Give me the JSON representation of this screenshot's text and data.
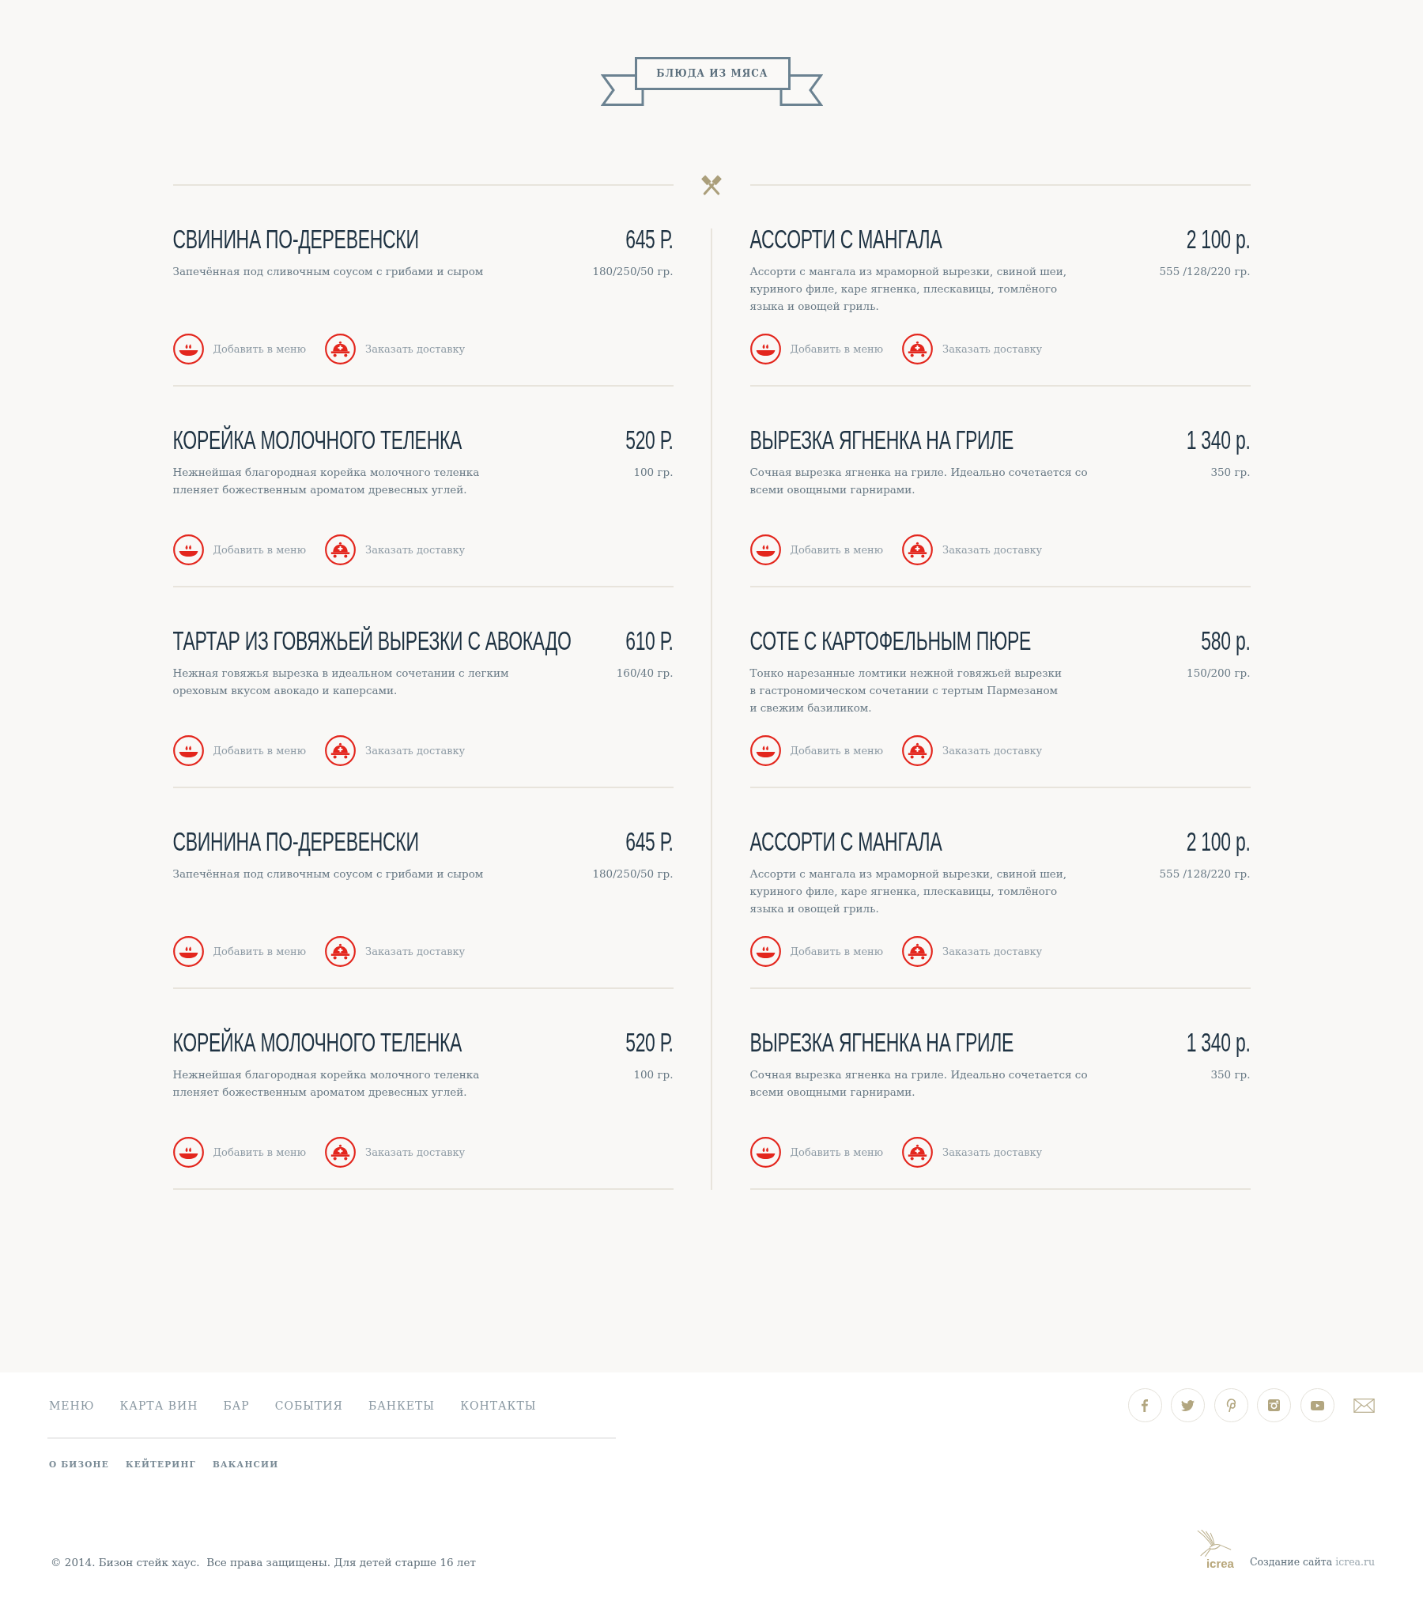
{
  "section_title": "БЛЮДА ИЗ МЯСА",
  "columns": [
    {
      "dishes": [
        {
          "name": "СВИНИНА ПО-ДЕРЕВЕНСКИ",
          "price": "645 Р.",
          "description": "Запечённая под сливочным соусом с грибами и сыром",
          "weight": "180/250/50 гр.",
          "actions": [
            {
              "kind": "add_to_menu",
              "label": "Добавить в меню"
            },
            {
              "kind": "order_delivery",
              "label": "Заказать доставку"
            }
          ]
        },
        {
          "name": "КОРЕЙКА МОЛОЧНОГО ТЕЛЕНКА",
          "price": "520 Р.",
          "description": "Нежнейшая благородная корейка молочного теленка\nпленяет божественным ароматом древесных углей.",
          "weight": "100 гр.",
          "actions": [
            {
              "kind": "add_to_menu",
              "label": "Добавить в меню"
            },
            {
              "kind": "order_delivery",
              "label": "Заказать доставку"
            }
          ]
        },
        {
          "name": "ТАРТАР ИЗ ГОВЯЖЬЕЙ ВЫРЕЗКИ С АВОКАДО",
          "price": "610 Р.",
          "description": "Нежная говяжья вырезка в идеальном сочетании с легким\nореховым вкусом авокадо и каперсами.",
          "weight": "160/40 гр.",
          "actions": [
            {
              "kind": "add_to_menu",
              "label": "Добавить в меню"
            },
            {
              "kind": "order_delivery",
              "label": "Заказать доставку"
            }
          ]
        },
        {
          "name": "СВИНИНА ПО-ДЕРЕВЕНСКИ",
          "price": "645 Р.",
          "description": "Запечённая под сливочным соусом с грибами и сыром",
          "weight": "180/250/50 гр.",
          "actions": [
            {
              "kind": "add_to_menu",
              "label": "Добавить в меню"
            },
            {
              "kind": "order_delivery",
              "label": "Заказать доставку"
            }
          ]
        },
        {
          "name": "КОРЕЙКА МОЛОЧНОГО ТЕЛЕНКА",
          "price": "520 Р.",
          "description": "Нежнейшая благородная корейка молочного теленка\nпленяет божественным ароматом древесных углей.",
          "weight": "100 гр.",
          "actions": [
            {
              "kind": "add_to_menu",
              "label": "Добавить в меню"
            },
            {
              "kind": "order_delivery",
              "label": "Заказать доставку"
            }
          ]
        }
      ]
    },
    {
      "dishes": [
        {
          "name": "АССОРТИ С МАНГАЛА",
          "price": "2 100 р.",
          "description": "Ассорти с мангала из мраморной вырезки, свиной шеи,\nкуриного филе, каре ягненка, плескавицы, томлёного\nязыка и овощей гриль.",
          "weight": "555 /128/220 гр.",
          "actions": [
            {
              "kind": "add_to_menu",
              "label": "Добавить в меню"
            },
            {
              "kind": "order_delivery",
              "label": "Заказать доставку"
            }
          ]
        },
        {
          "name": "ВЫРЕЗКА ЯГНЕНКА НА ГРИЛЕ",
          "price": "1 340 р.",
          "description": "Сочная вырезка ягненка на гриле. Идеально сочетается со\nвсеми овощными гарнирами.",
          "weight": "350 гр.",
          "actions": [
            {
              "kind": "add_to_menu",
              "label": "Добавить в меню"
            },
            {
              "kind": "order_delivery",
              "label": "Заказать доставку"
            }
          ]
        },
        {
          "name": "СОТЕ С КАРТОФЕЛЬНЫМ ПЮРЕ",
          "price": "580 р.",
          "description": "Тонко нарезанные ломтики нежной говяжьей вырезки\nв гастрономическом сочетании с тертым Пармезаном\nи свежим базиликом.",
          "weight": "150/200 гр.",
          "actions": [
            {
              "kind": "add_to_menu",
              "label": "Добавить в меню"
            },
            {
              "kind": "order_delivery",
              "label": "Заказать доставку"
            }
          ]
        },
        {
          "name": "АССОРТИ С МАНГАЛА",
          "price": "2 100 р.",
          "description": "Ассорти с мангала из мраморной вырезки, свиной шеи,\nкуриного филе, каре ягненка, плескавицы, томлёного\nязыка и овощей гриль.",
          "weight": "555 /128/220 гр.",
          "actions": [
            {
              "kind": "add_to_menu",
              "label": "Добавить в меню"
            },
            {
              "kind": "order_delivery",
              "label": "Заказать доставку"
            }
          ]
        },
        {
          "name": "ВЫРЕЗКА ЯГНЕНКА НА ГРИЛЕ",
          "price": "1 340 р.",
          "description": "Сочная вырезка ягненка на гриле. Идеально сочетается со\nвсеми овощными гарнирами.",
          "weight": "350 гр.",
          "actions": [
            {
              "kind": "add_to_menu",
              "label": "Добавить в меню"
            },
            {
              "kind": "order_delivery",
              "label": "Заказать доставку"
            }
          ]
        }
      ]
    }
  ],
  "footer": {
    "nav": [
      "МЕНЮ",
      "КАРТА ВИН",
      "БАР",
      "СОБЫТИЯ",
      "БАНКЕТЫ",
      "КОНТАКТЫ"
    ],
    "sub_nav": [
      "О БИЗОНЕ",
      "КЕЙТЕРИНГ",
      "ВАКАНСИИ"
    ],
    "copyright": "© 2014. Бизон стейк хаус.  Все права защищены. Для детей старше 16 лет",
    "credit": {
      "logo_text": "icrea",
      "text": "Создание сайта",
      "link": "icrea.ru"
    }
  }
}
